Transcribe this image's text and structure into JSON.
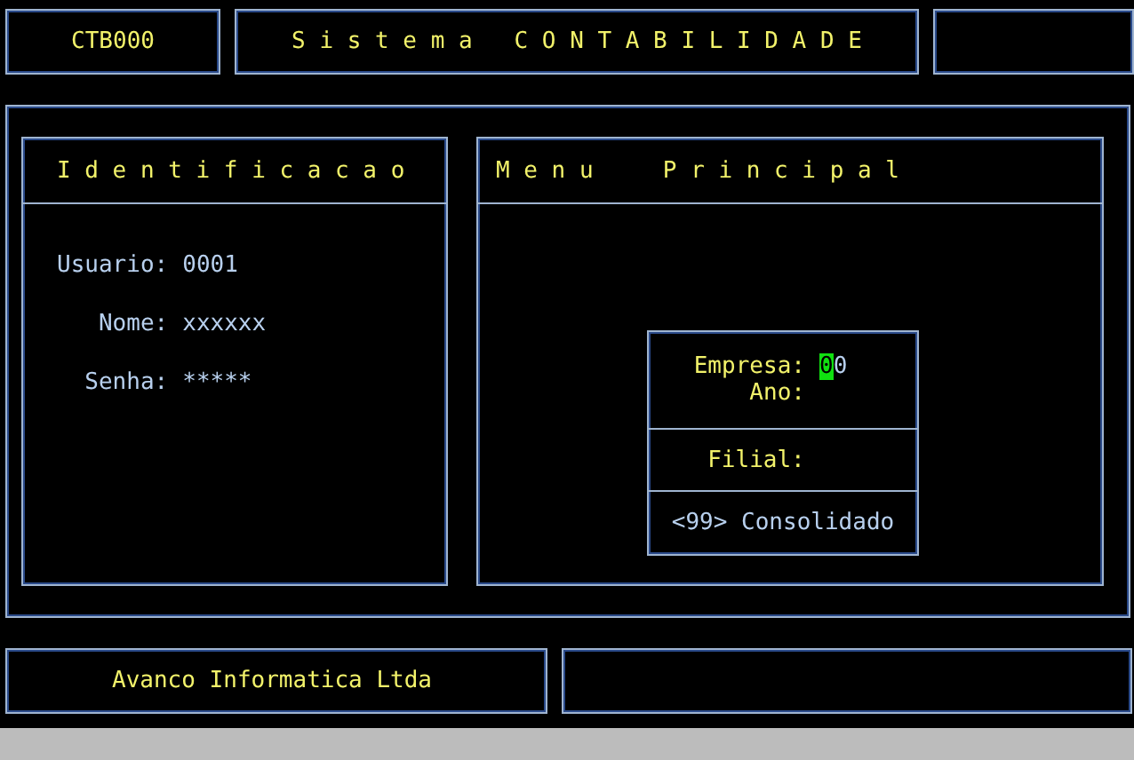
{
  "header": {
    "code": "CTB000",
    "title": "S i s t e m a   C O N T A B I L I D A D E"
  },
  "identification": {
    "title": "I d e n t i f i c a c a o",
    "fields": [
      {
        "label": "Usuario:",
        "value": "0001"
      },
      {
        "label": "Nome:",
        "value": "xxxxxx"
      },
      {
        "label": "Senha:",
        "value": "*****"
      }
    ]
  },
  "menu": {
    "title": "M e n u     P r i n c i p a l",
    "dialog": {
      "empresa": {
        "label": "Empresa:",
        "value": "00",
        "focused": true
      },
      "ano": {
        "label": "Ano:"
      },
      "filial": {
        "label": "Filial:"
      },
      "option": "<99> Consolidado"
    }
  },
  "footer": {
    "company": "Avanco Informatica Ltda"
  }
}
